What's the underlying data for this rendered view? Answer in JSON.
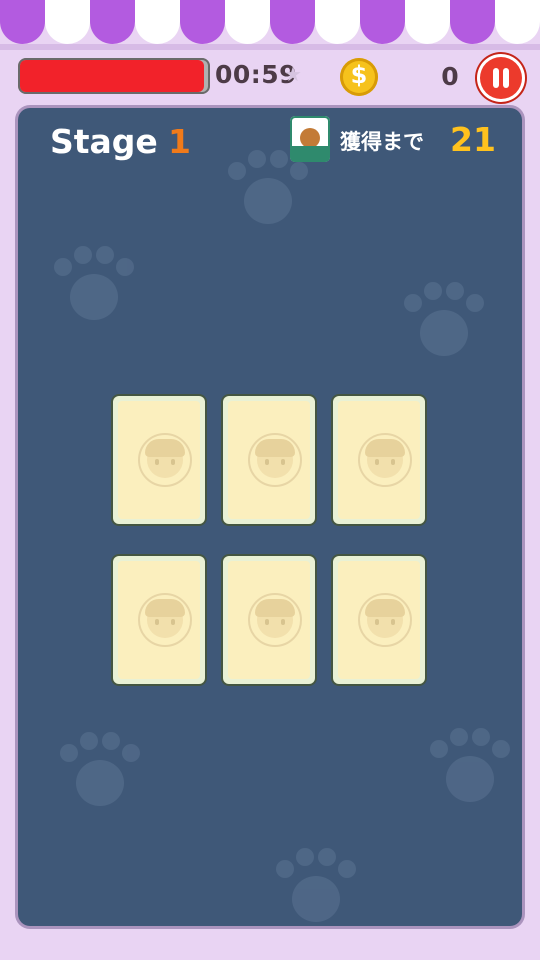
{
  "hud": {
    "timer_fraction": 0.98,
    "timer": "00:59",
    "coin_icon": "coin-icon",
    "coin_symbol": "$",
    "coins": "0",
    "pause_icon": "pause-icon"
  },
  "board": {
    "stage_label": "Stage",
    "stage_number": "1",
    "goal_icon": "pet-food-bag-icon",
    "goal_label": "獲得まで",
    "goal_number": "21"
  },
  "cards": [
    {
      "state": "face-down",
      "back_icon": "character-emblem-icon"
    },
    {
      "state": "face-down",
      "back_icon": "character-emblem-icon"
    },
    {
      "state": "face-down",
      "back_icon": "character-emblem-icon"
    },
    {
      "state": "face-down",
      "back_icon": "character-emblem-icon"
    },
    {
      "state": "face-down",
      "back_icon": "character-emblem-icon"
    },
    {
      "state": "face-down",
      "back_icon": "character-emblem-icon"
    }
  ],
  "colors": {
    "awning_purple": "#b35be0",
    "timer_red": "#f2222a",
    "board_blue": "#3f5878",
    "stage_orange": "#f07a1a",
    "goal_gold": "#ffc21e",
    "pause_red": "#ec3a2c"
  }
}
